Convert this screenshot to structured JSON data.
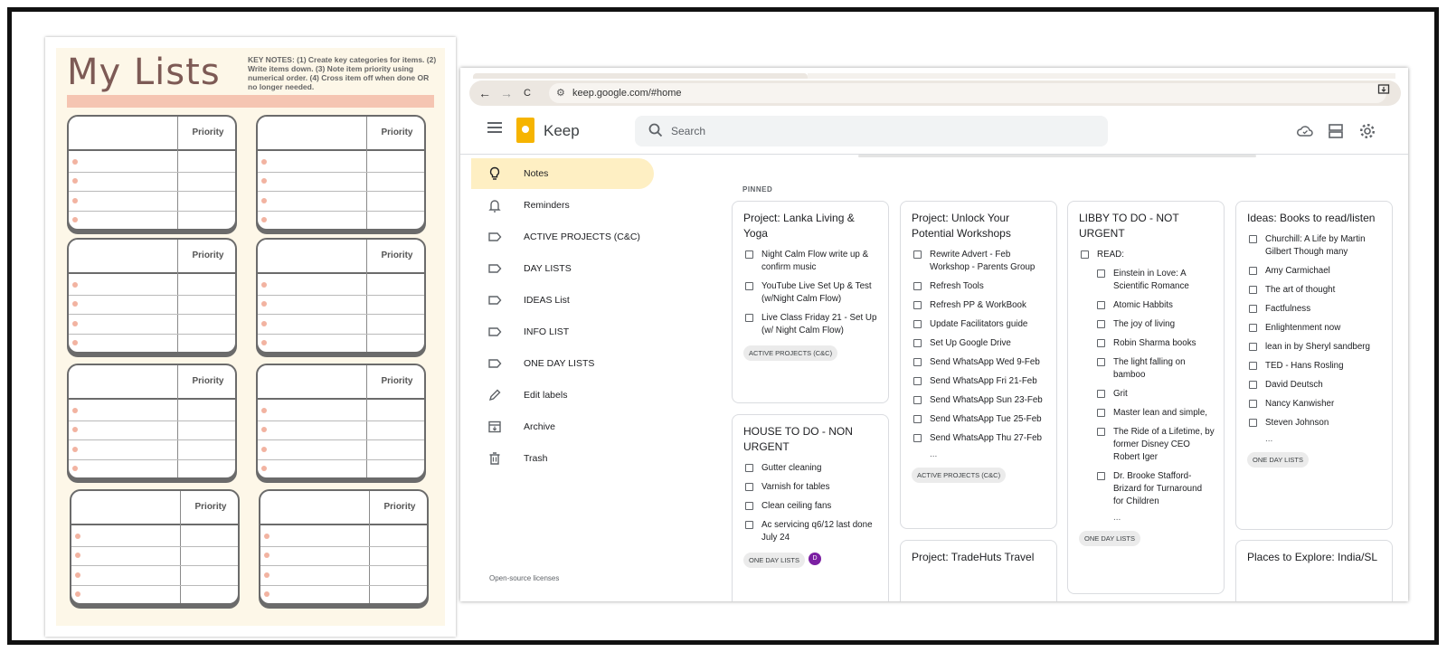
{
  "sheet": {
    "title": "My Lists",
    "key_notes": "KEY NOTES: (1) Create key categories for items. (2) Write items down. (3) Note item priority using numerical order. (4) Cross item off when done OR no longer needed.",
    "priority_label": "Priority"
  },
  "browser": {
    "back": "←",
    "forward": "→",
    "reload": "C",
    "url": "keep.google.com/#home"
  },
  "keep": {
    "app_name": "Keep",
    "search_placeholder": "Search",
    "pinned_label": "PINNED",
    "open_source": "Open-source licenses",
    "sidebar": [
      {
        "label": "Notes"
      },
      {
        "label": "Reminders"
      },
      {
        "label": "ACTIVE PROJECTS (C&C)"
      },
      {
        "label": "DAY LISTS"
      },
      {
        "label": "IDEAS List"
      },
      {
        "label": "INFO LIST"
      },
      {
        "label": "ONE DAY LISTS"
      },
      {
        "label": "Edit labels"
      },
      {
        "label": "Archive"
      },
      {
        "label": "Trash"
      }
    ],
    "notes": {
      "lanka": {
        "title": "Project: Lanka Living & Yoga",
        "items": [
          "Night Calm Flow write up & confirm music",
          "YouTube Live Set Up & Test (w/Night Calm Flow)",
          "Live Class Friday 21 - Set Up (w/ Night Calm Flow)"
        ],
        "label": "ACTIVE PROJECTS (C&C)"
      },
      "house": {
        "title": "HOUSE TO DO - NON URGENT",
        "items": [
          "Gutter cleaning",
          "Varnish for tables",
          "Clean ceiling fans",
          "Ac servicing q6/12 last done July 24"
        ],
        "label": "ONE DAY LISTS",
        "avatar": "D"
      },
      "unlock": {
        "title": "Project: Unlock Your Potential Workshops",
        "items": [
          "Rewrite Advert - Feb Workshop - Parents Group",
          "Refresh Tools",
          "Refresh PP & WorkBook",
          "Update Facilitators guide",
          "Set Up Google Drive",
          "Send WhatsApp Wed 9-Feb",
          "Send WhatsApp Fri 21-Feb",
          "Send WhatsApp Sun 23-Feb",
          "Send WhatsApp Tue 25-Feb",
          "Send WhatsApp Thu 27-Feb"
        ],
        "ellipsis": "...",
        "label": "ACTIVE PROJECTS (C&C)"
      },
      "tradehuts": {
        "title": "Project: TradeHuts Travel"
      },
      "libby": {
        "title": "LIBBY TO DO - NOT URGENT",
        "parent": "READ:",
        "items": [
          "Einstein in Love: A Scientific Romance",
          "Atomic Habbits",
          "The joy of living",
          "Robin Sharma books",
          "The light falling on bamboo",
          "Grit",
          "Master lean and simple,",
          "The Ride of a Lifetime, by former Disney CEO Robert Iger",
          "Dr. Brooke Stafford-Brizard for Turnaround for Children"
        ],
        "ellipsis": "...",
        "label": "ONE DAY LISTS"
      },
      "books": {
        "title": "Ideas: Books to read/listen",
        "items": [
          "Churchill: A Life by Martin Gilbert Though many",
          "Amy Carmichael",
          "The art of thought",
          "Factfulness",
          "Enlightenment now",
          "lean in by Sheryl sandberg",
          "TED - Hans Rosling",
          "David Deutsch",
          "Nancy Kanwisher",
          "Steven Johnson"
        ],
        "ellipsis": "...",
        "label": "ONE DAY LISTS"
      },
      "places": {
        "title": "Places to Explore: India/SL"
      }
    }
  }
}
